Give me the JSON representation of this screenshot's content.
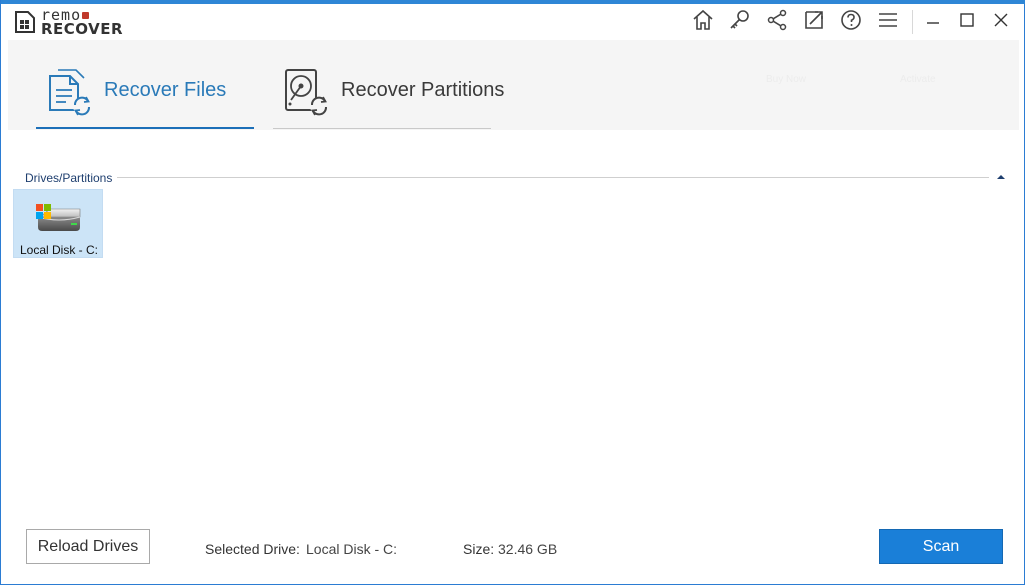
{
  "app": {
    "logo_top": "remo",
    "logo_bottom": "RECOVER"
  },
  "toolbar": {
    "icons": [
      "home-icon",
      "key-icon",
      "share-icon",
      "export-icon",
      "help-icon",
      "menu-icon",
      "minimize-icon",
      "maximize-icon",
      "close-icon"
    ]
  },
  "tabs": [
    {
      "label": "Recover Files",
      "active": true
    },
    {
      "label": "Recover Partitions",
      "active": false
    }
  ],
  "ghost_links": [
    "Buy Now",
    "Activate"
  ],
  "drives_section": {
    "header": "Drives/Partitions",
    "drives": [
      {
        "label": "Local Disk - C:",
        "selected": true
      }
    ]
  },
  "footer": {
    "reload_label": "Reload Drives",
    "selected_drive_label": "Selected Drive:",
    "selected_drive_value": "Local Disk - C:",
    "size_label": "Size:",
    "size_value": "32.46 GB",
    "scan_label": "Scan"
  },
  "colors": {
    "accent": "#1a7fd8",
    "tab_active_text": "#2a7ab8",
    "selection_bg": "#cce4f7",
    "title_accent": "#2e86d6"
  }
}
